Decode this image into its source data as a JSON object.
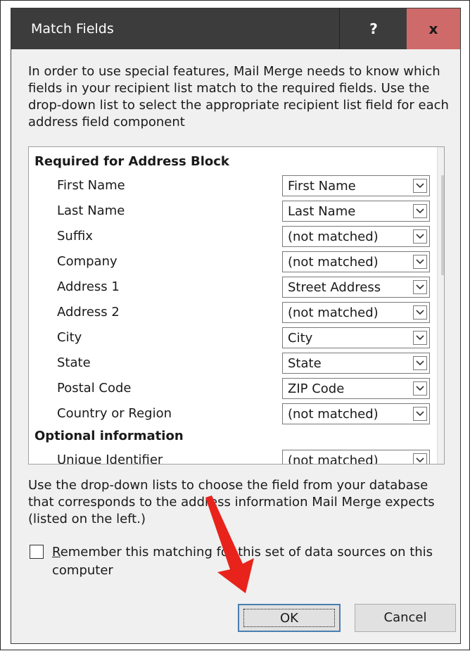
{
  "window": {
    "title": "Match Fields",
    "help_glyph": "?",
    "close_glyph": "x"
  },
  "intro_text": "In order to use special features, Mail Merge needs to know which fields in your recipient list match to the required fields.  Use the drop-down list to select the appropriate recipient list field for each address field component",
  "sections": [
    {
      "header": "Required for Address Block",
      "fields": [
        {
          "label": "First Name",
          "value": "First Name"
        },
        {
          "label": "Last Name",
          "value": "Last Name"
        },
        {
          "label": "Suffix",
          "value": "(not matched)"
        },
        {
          "label": "Company",
          "value": "(not matched)"
        },
        {
          "label": "Address 1",
          "value": "Street Address"
        },
        {
          "label": "Address 2",
          "value": "(not matched)"
        },
        {
          "label": "City",
          "value": "City"
        },
        {
          "label": "State",
          "value": "State"
        },
        {
          "label": "Postal Code",
          "value": "ZIP Code"
        },
        {
          "label": "Country or Region",
          "value": "(not matched)"
        }
      ]
    },
    {
      "header": "Optional information",
      "fields": [
        {
          "label": "Unique Identifier",
          "value": "(not matched)"
        }
      ]
    }
  ],
  "help_text": "Use the drop-down lists to choose the field from your database that corresponds to the address information Mail Merge expects (listed on the left.)",
  "remember_checkbox": {
    "checked": false,
    "label_first_letter": "R",
    "label_rest": "emember this matching for this set of data sources on this computer"
  },
  "buttons": {
    "ok_label": "OK",
    "cancel_label": "Cancel"
  },
  "colors": {
    "titlebar": "#3c3c3c",
    "close_button": "#cf6a6a",
    "annotation_arrow": "#e8231c",
    "ok_border": "#4a7fb0"
  }
}
